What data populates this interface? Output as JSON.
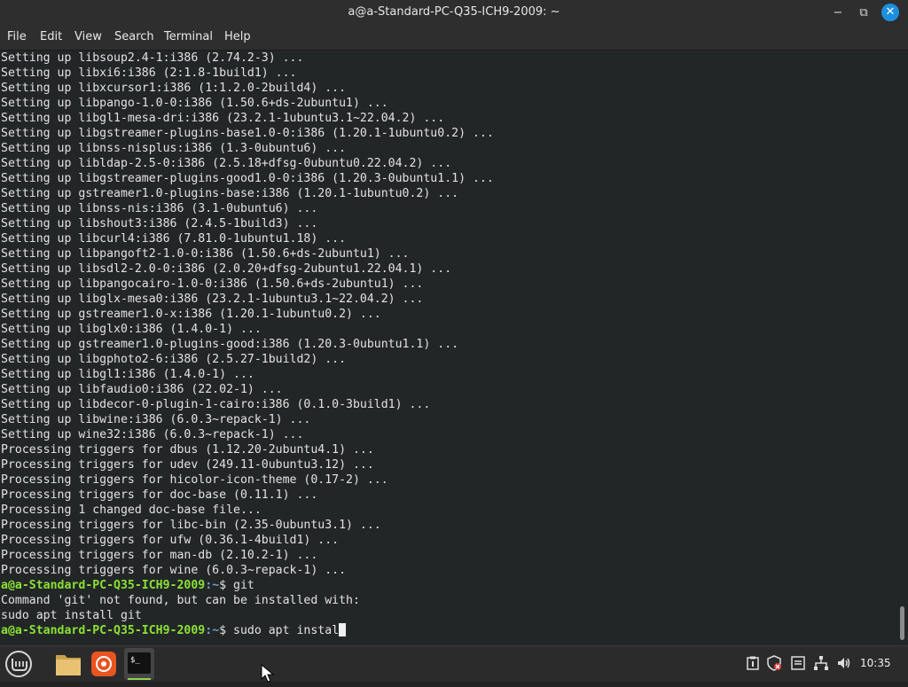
{
  "window": {
    "title": "a@a-Standard-PC-Q35-ICH9-2009: ~",
    "minimize_label": "−",
    "maximize_label": "⧉",
    "close_label": "✕"
  },
  "menu": {
    "items": [
      "File",
      "Edit",
      "View",
      "Search",
      "Terminal",
      "Help"
    ]
  },
  "terminal": {
    "output_lines": [
      "Setting up libsoup2.4-1:i386 (2.74.2-3) ...",
      "Setting up libxi6:i386 (2:1.8-1build1) ...",
      "Setting up libxcursor1:i386 (1:1.2.0-2build4) ...",
      "Setting up libpango-1.0-0:i386 (1.50.6+ds-2ubuntu1) ...",
      "Setting up libgl1-mesa-dri:i386 (23.2.1-1ubuntu3.1~22.04.2) ...",
      "Setting up libgstreamer-plugins-base1.0-0:i386 (1.20.1-1ubuntu0.2) ...",
      "Setting up libnss-nisplus:i386 (1.3-0ubuntu6) ...",
      "Setting up libldap-2.5-0:i386 (2.5.18+dfsg-0ubuntu0.22.04.2) ...",
      "Setting up libgstreamer-plugins-good1.0-0:i386 (1.20.3-0ubuntu1.1) ...",
      "Setting up gstreamer1.0-plugins-base:i386 (1.20.1-1ubuntu0.2) ...",
      "Setting up libnss-nis:i386 (3.1-0ubuntu6) ...",
      "Setting up libshout3:i386 (2.4.5-1build3) ...",
      "Setting up libcurl4:i386 (7.81.0-1ubuntu1.18) ...",
      "Setting up libpangoft2-1.0-0:i386 (1.50.6+ds-2ubuntu1) ...",
      "Setting up libsdl2-2.0-0:i386 (2.0.20+dfsg-2ubuntu1.22.04.1) ...",
      "Setting up libpangocairo-1.0-0:i386 (1.50.6+ds-2ubuntu1) ...",
      "Setting up libglx-mesa0:i386 (23.2.1-1ubuntu3.1~22.04.2) ...",
      "Setting up gstreamer1.0-x:i386 (1.20.1-1ubuntu0.2) ...",
      "Setting up libglx0:i386 (1.4.0-1) ...",
      "Setting up gstreamer1.0-plugins-good:i386 (1.20.3-0ubuntu1.1) ...",
      "Setting up libgphoto2-6:i386 (2.5.27-1build2) ...",
      "Setting up libgl1:i386 (1.4.0-1) ...",
      "Setting up libfaudio0:i386 (22.02-1) ...",
      "Setting up libdecor-0-plugin-1-cairo:i386 (0.1.0-3build1) ...",
      "Setting up libwine:i386 (6.0.3~repack-1) ...",
      "Setting up wine32:i386 (6.0.3~repack-1) ...",
      "Processing triggers for dbus (1.12.20-2ubuntu4.1) ...",
      "Processing triggers for udev (249.11-0ubuntu3.12) ...",
      "Processing triggers for hicolor-icon-theme (0.17-2) ...",
      "Processing triggers for doc-base (0.11.1) ...",
      "Processing 1 changed doc-base file...",
      "Processing triggers for libc-bin (2.35-0ubuntu3.1) ...",
      "Processing triggers for ufw (0.36.1-4build1) ...",
      "Processing triggers for man-db (2.10.2-1) ...",
      "Processing triggers for wine (6.0.3~repack-1) ..."
    ],
    "prompt_user": "a@a-Standard-PC-Q35-ICH9-2009",
    "prompt_path": ":~",
    "prompt_symbol": "$ ",
    "command_1": "git",
    "error_line_1": "Command 'git' not found, but can be installed with:",
    "error_line_2": "sudo apt install git",
    "current_input": "sudo apt instal"
  },
  "taskbar": {
    "apps": [
      "menu-icon",
      "files-icon",
      "firefox-icon",
      "terminal-icon"
    ],
    "tray_icons": [
      "clipboard-icon",
      "shield-icon",
      "update-icon",
      "network-icon",
      "volume-icon"
    ],
    "clock": "10:35"
  },
  "colors": {
    "terminal_bg": "#232627",
    "prompt_user": "#8ae234",
    "prompt_path": "#729fcf",
    "accent_close": "#1d8fde"
  }
}
